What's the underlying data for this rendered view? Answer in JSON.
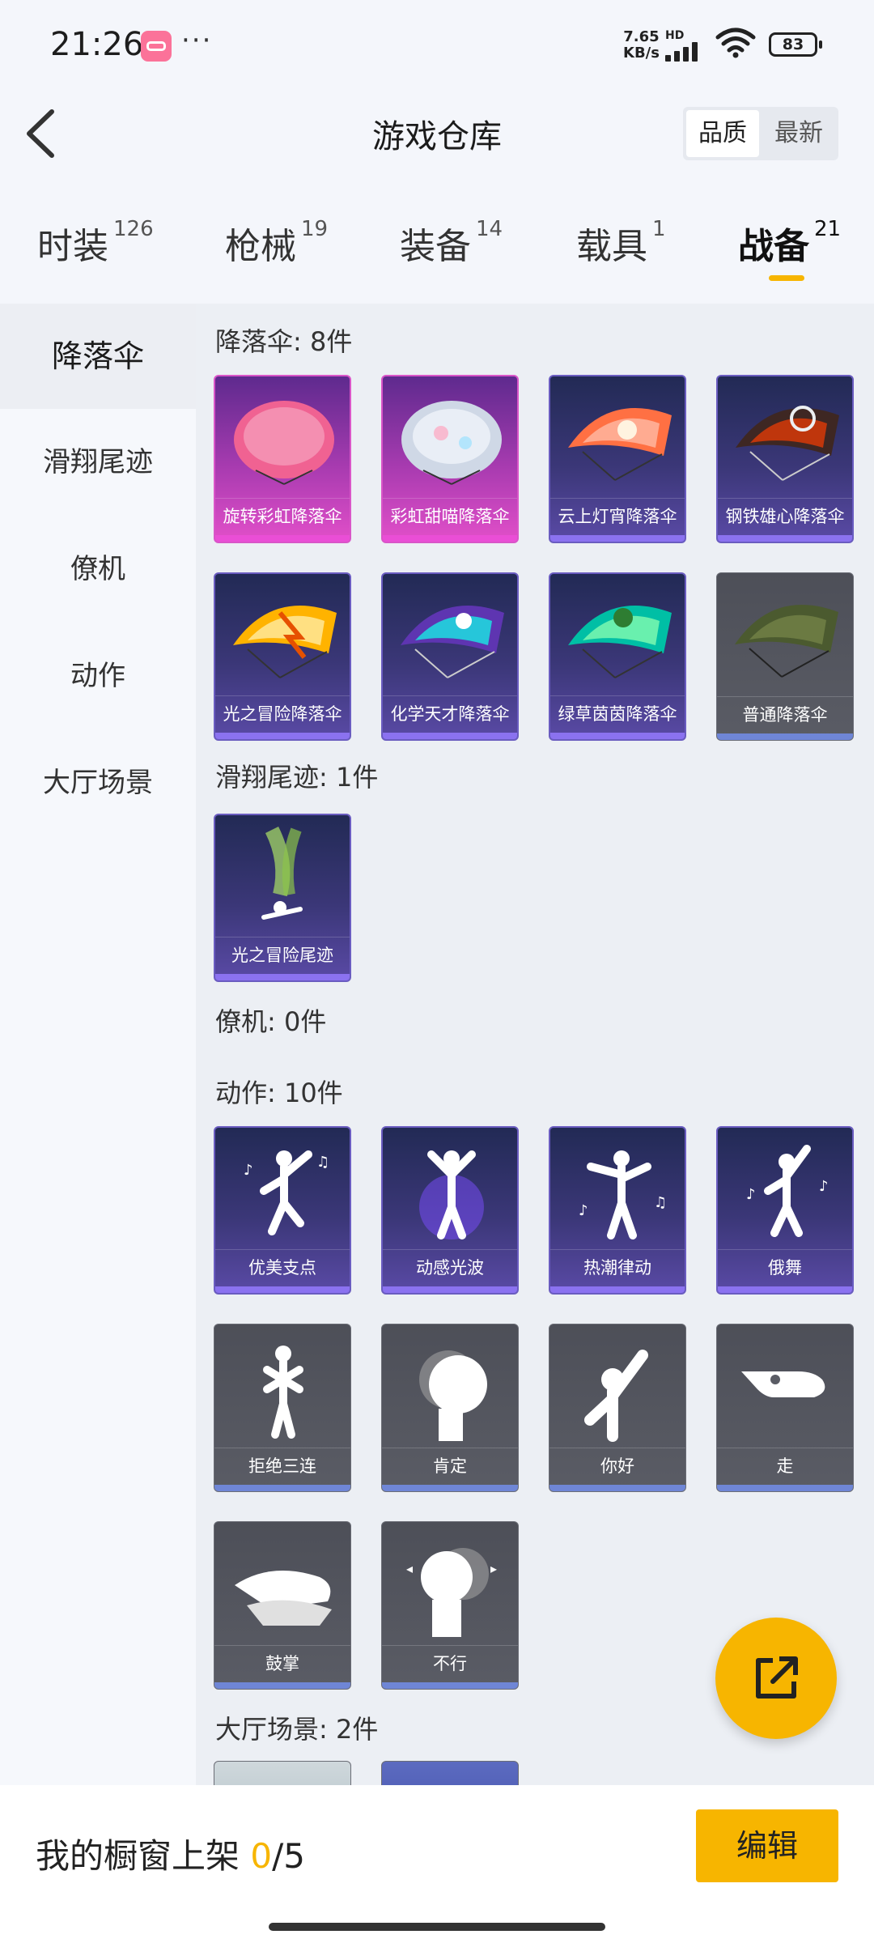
{
  "status": {
    "time": "21:26",
    "dots": "···",
    "speed_value": "7.65",
    "speed_unit": "KB/s",
    "hd": "HD",
    "battery": "83"
  },
  "header": {
    "title": "游戏仓库",
    "sort_quality": "品质",
    "sort_newest": "最新"
  },
  "tabs": [
    {
      "label": "时装",
      "count": "126"
    },
    {
      "label": "枪械",
      "count": "19"
    },
    {
      "label": "装备",
      "count": "14"
    },
    {
      "label": "载具",
      "count": "1"
    },
    {
      "label": "战备",
      "count": "21"
    }
  ],
  "sidebar": {
    "items": [
      {
        "label": "降落伞"
      },
      {
        "label": "滑翔尾迹"
      },
      {
        "label": "僚机"
      },
      {
        "label": "动作"
      },
      {
        "label": "大厅场景"
      }
    ]
  },
  "sections": {
    "parachute": {
      "title": "降落伞: 8件",
      "items": [
        "旋转彩虹降落伞",
        "彩虹甜喵降落伞",
        "云上灯宵降落伞",
        "钢铁雄心降落伞",
        "光之冒险降落伞",
        "化学天才降落伞",
        "绿草茵茵降落伞",
        "普通降落伞"
      ]
    },
    "trail": {
      "title": "滑翔尾迹: 1件",
      "items": [
        "光之冒险尾迹"
      ]
    },
    "wingman": {
      "title": "僚机: 0件"
    },
    "emote": {
      "title": "动作: 10件",
      "items": [
        "优美支点",
        "动感光波",
        "热潮律动",
        "俄舞",
        "拒绝三连",
        "肯定",
        "你好",
        "走",
        "鼓掌",
        "不行"
      ]
    },
    "lobby": {
      "title": "大厅场景: 2件"
    }
  },
  "bottom": {
    "label": "我的橱窗上架 ",
    "current": "0",
    "separator": "/",
    "total": "5",
    "edit": "编辑"
  },
  "colors": {
    "accent": "#f7b500",
    "rarity_pink": "#ea4ed6",
    "rarity_purple": "#8b72f0",
    "rarity_gray": "#6f86d6"
  }
}
